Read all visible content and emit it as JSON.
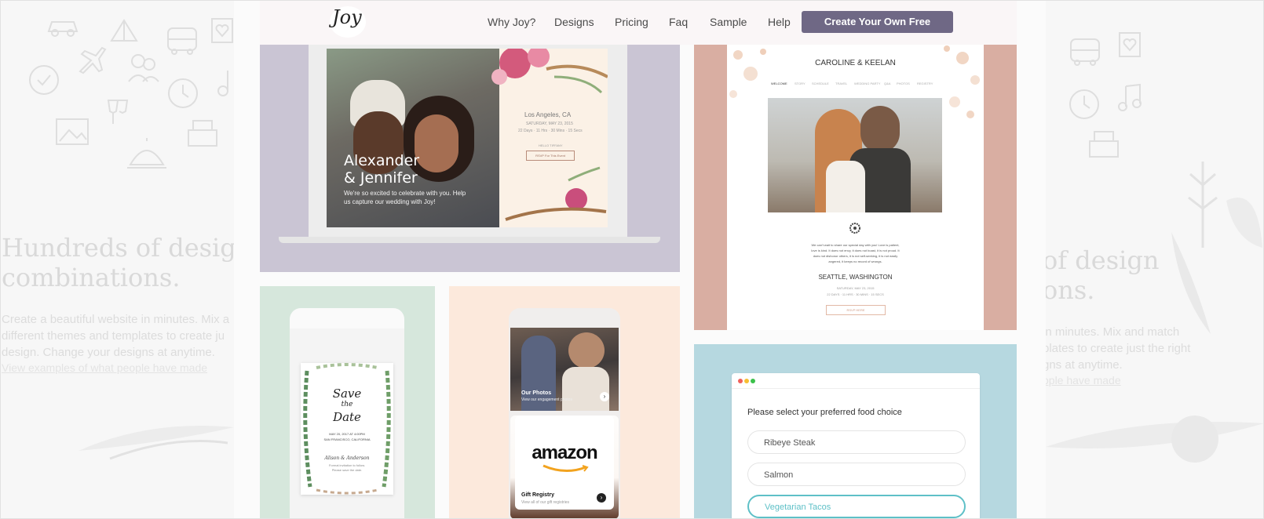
{
  "nav": {
    "logo": "Joy",
    "links": [
      "Why Joy?",
      "Designs",
      "Pricing",
      "Faq",
      "Sample",
      "Help"
    ],
    "cta": "Create Your Own Free"
  },
  "hero": {
    "title_line1": "Hundreds of design",
    "title_line2": "combinations.",
    "text_line1": "Create a beautiful website in minutes. Mix a",
    "text_line2": "different themes and templates to create ju",
    "text_line3": "design. Change your designs at anytime.",
    "link": "View examples of what people have made",
    "right_title_line1": "of design",
    "right_title_line2": "ons.",
    "right_text_line1": "in minutes. Mix and match",
    "right_text_line2": "plates to create just the right",
    "right_text_line3": "gns at anytime.",
    "right_link": "ople have made"
  },
  "laptop_card": {
    "couple_name_line1": "Alexander",
    "couple_name_line2": "& Jennifer",
    "intro_line1": "We're so excited to celebrate with you. Help",
    "intro_line2": "us capture our wedding with Joy!",
    "location": "Los Angeles, CA",
    "date": "SATURDAY, MAY 23, 2015",
    "countdown": "22 Days · 11 Hrs · 30 Mins · 15 Secs",
    "hello": "HELLO TIFFANY",
    "rsvp": "RSVP For This Event"
  },
  "site_card": {
    "couple": "CAROLINE & KEELAN",
    "menu": [
      "WELCOME",
      "STORY",
      "SCHEDULE",
      "TRAVEL",
      "WEDDING PARTY",
      "Q&A",
      "PHOTOS",
      "REGISTRY"
    ],
    "paragraph_lines": [
      "We can't wait to share our special day with you! Love is patient,",
      "love is kind. It does not envy, it does not boast, it is not proud. It",
      "does not dishonor others, it is not self-seeking, it is not easily",
      "angered, it keeps no record of wrongs."
    ],
    "location": "SEATTLE, WASHINGTON",
    "date": "SATURDAY, MAY 23, 2015",
    "countdown": "22 DAYS · 11 HRS · 30 MINS · 15 SECS",
    "button": "RSVP HERE"
  },
  "save_date_card": {
    "title_line1": "Save",
    "title_line2": "the",
    "title_line3": "Date",
    "date_line": "MAY 20, 2017 AT 4:00PM",
    "place_line": "SAN FRANCISCO, CALIFORNIA",
    "names": "Alison & Anderson",
    "note_line1": "Formal invitation to follow.",
    "note_line2": "Please save the date."
  },
  "phone_card": {
    "photos_title": "Our Photos",
    "photos_sub": "View our engagement photos",
    "amazon": "amazon",
    "registry_title": "Gift Registry",
    "registry_sub": "View all of our gift registries"
  },
  "food_card": {
    "question": "Please select your preferred food choice",
    "options": [
      "Ribeye Steak",
      "Salmon",
      "Vegetarian Tacos"
    ],
    "selected_index": 2
  },
  "colors": {
    "cta": "#6f6885",
    "laptop_bg": "#cac5d4",
    "site_bg": "#d9aea2",
    "green_bg": "#d6e7dc",
    "peach_bg": "#fce9dc",
    "blue_bg": "#b6d8e0",
    "selected": "#5ec0c7"
  }
}
